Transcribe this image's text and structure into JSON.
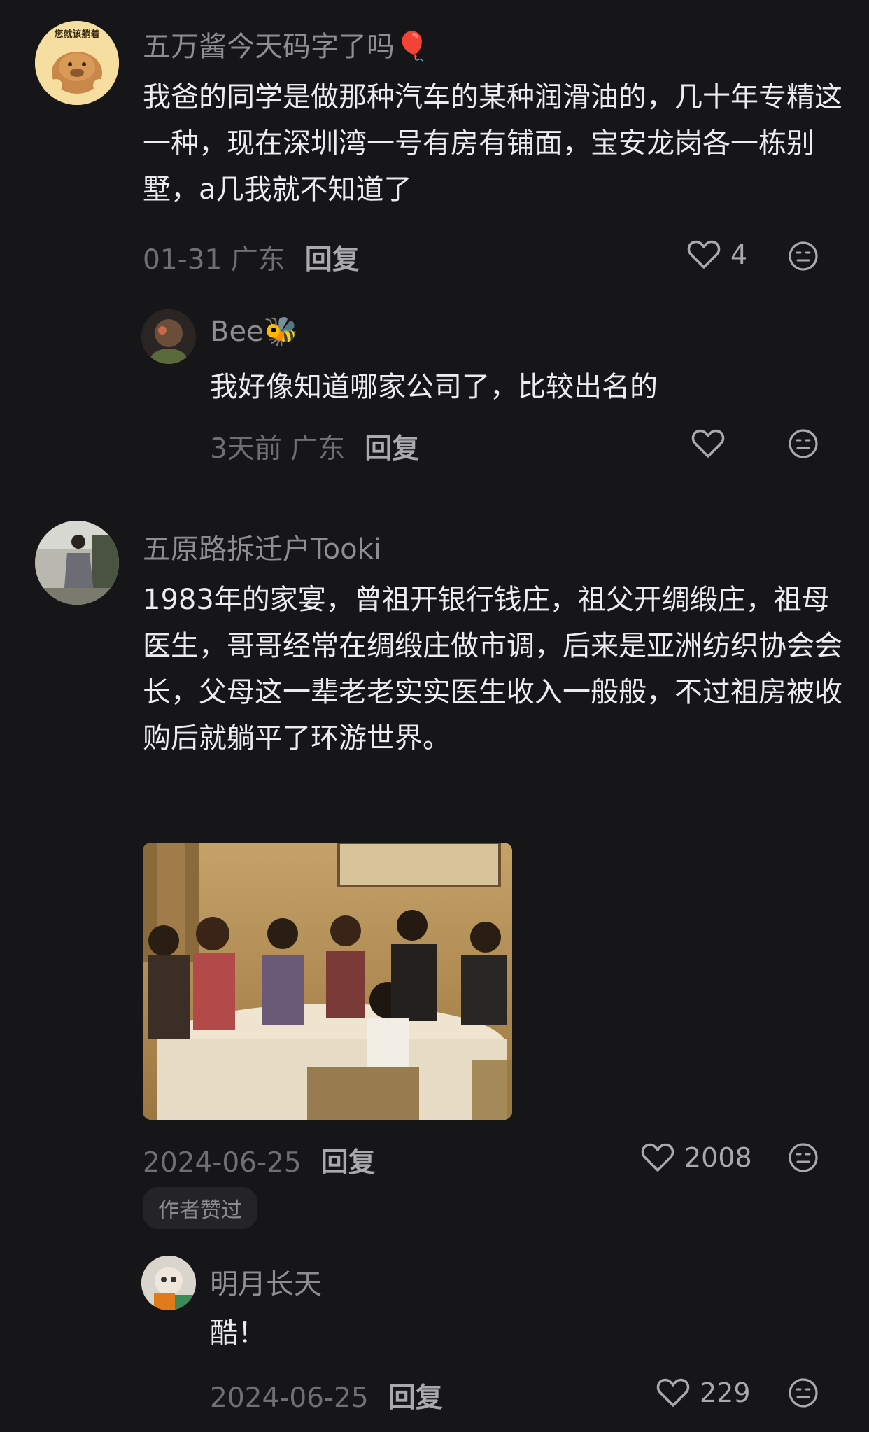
{
  "comments": [
    {
      "author": "五万酱今天码字了吗🎈",
      "avatar_text": "您就该躺着",
      "text": "我爸的同学是做那种汽车的某种润滑油的，几十年专精这一种，现在深圳湾一号有房有铺面，宝安龙岗各一栋别墅，a几我就不知道了",
      "meta": "01-31 广东",
      "reply_label": "回复",
      "likes": "4",
      "replies": [
        {
          "author": "Bee🐝",
          "text": "我好像知道哪家公司了，比较出名的",
          "meta": "3天前 广东",
          "reply_label": "回复",
          "likes": ""
        }
      ]
    },
    {
      "author": "五原路拆迁户Tooki",
      "text": "1983年的家宴，曾祖开银行钱庄，祖父开绸缎庄，祖母医生，哥哥经常在绸缎庄做市调，后来是亚洲纺织协会会长，父母这一辈老老实实医生收入一般般，不过祖房被收购后就躺平了环游世界。",
      "meta": "2024-06-25",
      "reply_label": "回复",
      "likes": "2008",
      "badge": "作者赞过",
      "replies": [
        {
          "author": "明月长天",
          "text": "酷！",
          "meta": "2024-06-25",
          "reply_label": "回复",
          "likes": "229"
        }
      ]
    }
  ],
  "colors": {
    "background": "#161618",
    "text": "#ececee",
    "meta": "#6f6f74",
    "name": "#8d8d92"
  }
}
